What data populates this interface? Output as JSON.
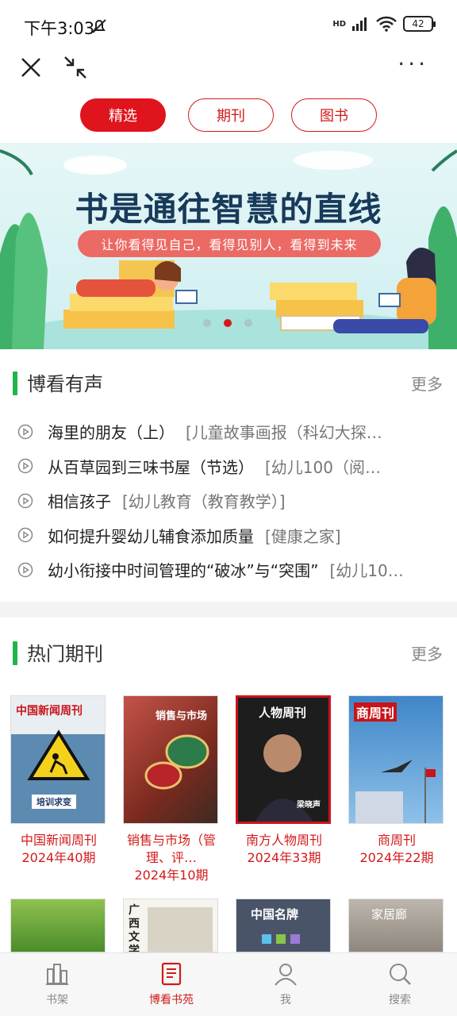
{
  "status": {
    "time": "下午3:03",
    "network": "HD",
    "battery": "42"
  },
  "tabs": [
    {
      "label": "精选",
      "active": true
    },
    {
      "label": "期刊",
      "active": false
    },
    {
      "label": "图书",
      "active": false
    }
  ],
  "banner": {
    "title": "书是通往智慧的直线",
    "subtitle": "让你看得见自己，看得见别人，看得到未来",
    "slides": 3,
    "active_slide": 2
  },
  "audio_section": {
    "title": "博看有声",
    "more": "更多",
    "items": [
      {
        "title": "海里的朋友（上）",
        "tag": "[儿童故事画报（科幻大探…"
      },
      {
        "title": "从百草园到三味书屋（节选）",
        "tag": "[幼儿100（阅…"
      },
      {
        "title": "相信孩子",
        "tag": "[幼儿教育（教育教学）]"
      },
      {
        "title": "如何提升婴幼儿辅食添加质量",
        "tag": "[健康之家]"
      },
      {
        "title": "幼小衔接中时间管理的“破冰”与“突围”",
        "tag": "[幼儿10…"
      }
    ]
  },
  "magazine_section": {
    "title": "热门期刊",
    "more": "更多",
    "items": [
      {
        "name": "中国新闻周刊",
        "issue": "2024年40期",
        "cover_title": "中国新闻周刊",
        "cover_sub": "培训求变"
      },
      {
        "name": "销售与市场（管理、评…",
        "issue": "2024年10期",
        "cover_title": "销售与市场",
        "cover_sub": ""
      },
      {
        "name": "南方人物周刊",
        "issue": "2024年33期",
        "cover_title": "人物周刊",
        "cover_sub": "梁晓声"
      },
      {
        "name": "商周刊",
        "issue": "2024年22期",
        "cover_title": "商周刊",
        "cover_sub": ""
      },
      {
        "name": "",
        "issue": "",
        "cover_title": "",
        "cover_sub": ""
      },
      {
        "name": "",
        "issue": "",
        "cover_title": "广西文学",
        "cover_sub": ""
      },
      {
        "name": "",
        "issue": "",
        "cover_title": "中国名牌",
        "cover_sub": ""
      },
      {
        "name": "",
        "issue": "",
        "cover_title": "家居廊",
        "cover_sub": ""
      }
    ]
  },
  "bottom_nav": [
    {
      "label": "书架",
      "active": false
    },
    {
      "label": "博看书苑",
      "active": true
    },
    {
      "label": "我",
      "active": false
    },
    {
      "label": "搜索",
      "active": false
    }
  ],
  "colors": {
    "accent": "#e0141c",
    "section_bar": "#20b54a"
  }
}
